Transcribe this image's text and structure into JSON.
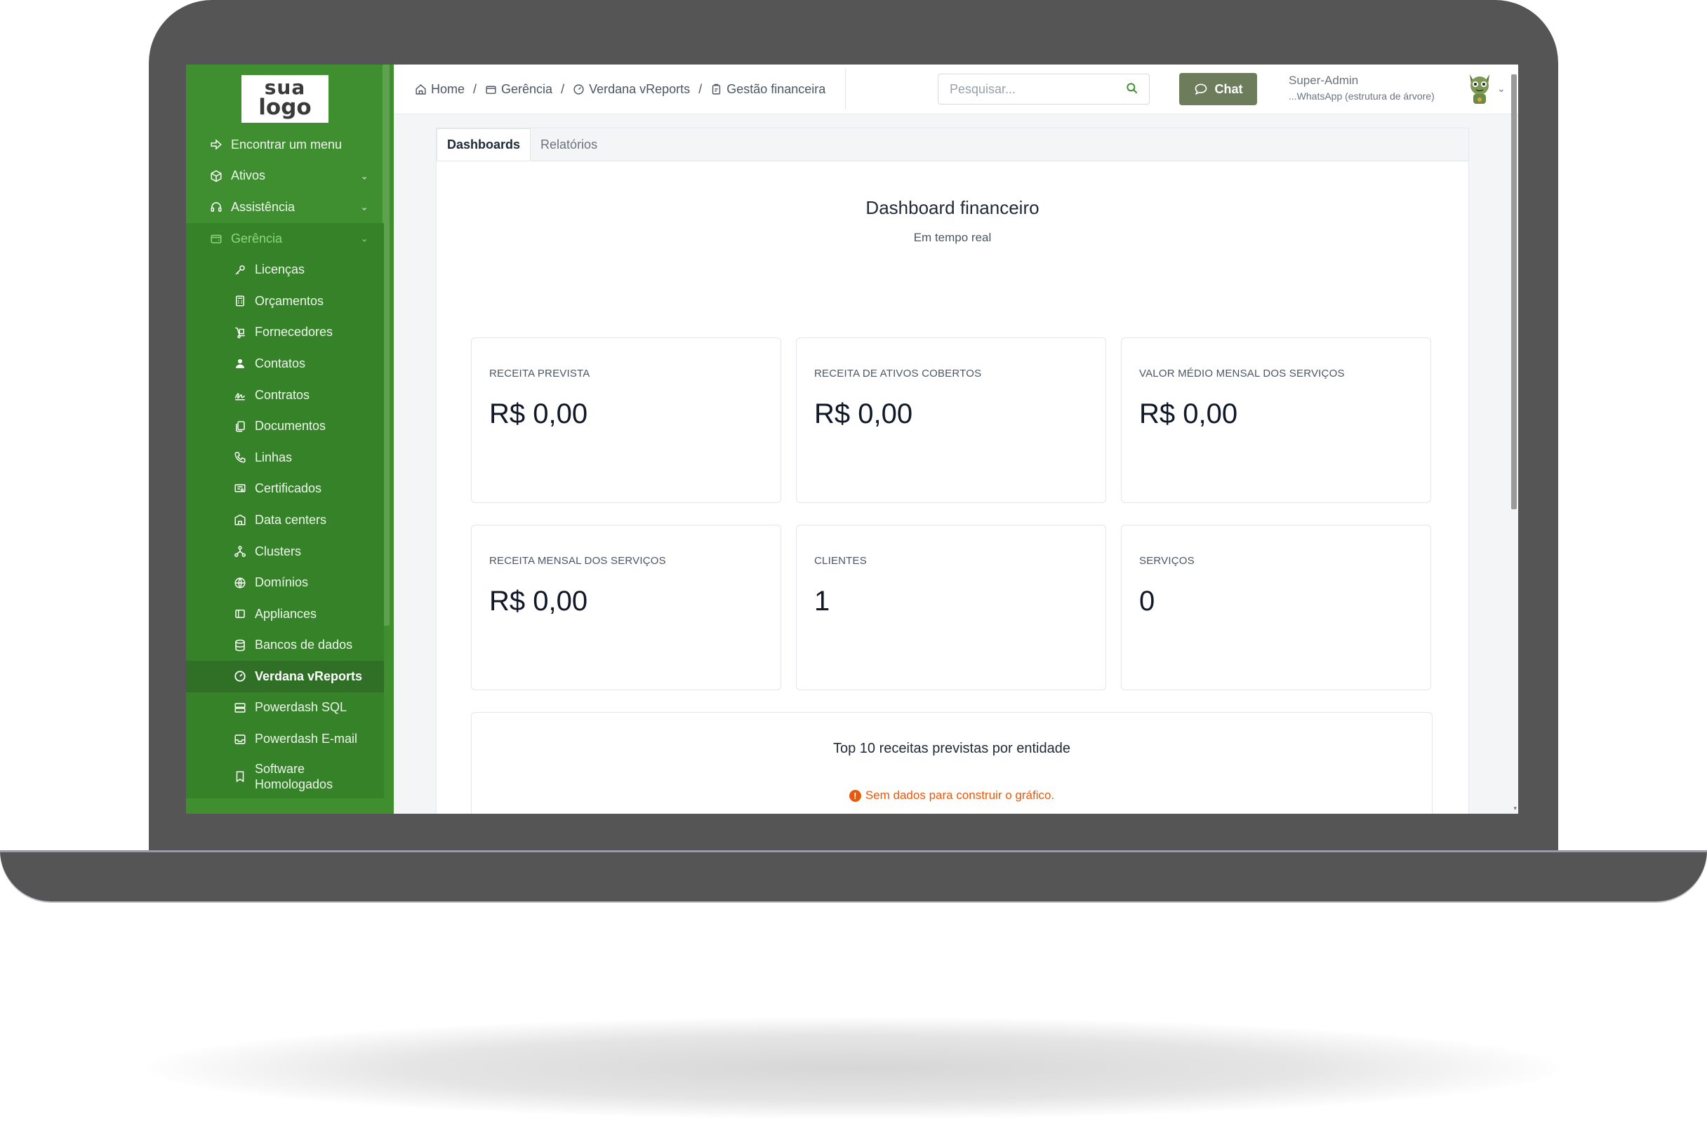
{
  "logo": {
    "line1": "sua",
    "line2": "logo"
  },
  "sidebar": {
    "items": [
      {
        "label": "Encontrar um menu",
        "icon": "arrow-right-icon"
      },
      {
        "label": "Ativos",
        "icon": "cube-icon"
      },
      {
        "label": "Assistência",
        "icon": "headset-icon"
      },
      {
        "label": "Gerência",
        "icon": "wallet-icon"
      }
    ],
    "subitems": [
      {
        "label": "Licenças",
        "icon": "key-icon"
      },
      {
        "label": "Orçamentos",
        "icon": "calculator-icon"
      },
      {
        "label": "Fornecedores",
        "icon": "dolly-icon"
      },
      {
        "label": "Contatos",
        "icon": "user-icon"
      },
      {
        "label": "Contratos",
        "icon": "signature-icon"
      },
      {
        "label": "Documentos",
        "icon": "files-icon"
      },
      {
        "label": "Linhas",
        "icon": "phone-icon"
      },
      {
        "label": "Certificados",
        "icon": "certificate-icon"
      },
      {
        "label": "Data centers",
        "icon": "building-icon"
      },
      {
        "label": "Clusters",
        "icon": "network-icon"
      },
      {
        "label": "Domínios",
        "icon": "globe-icon"
      },
      {
        "label": "Appliances",
        "icon": "device-icon"
      },
      {
        "label": "Bancos de dados",
        "icon": "database-icon"
      },
      {
        "label": "Verdana vReports",
        "icon": "gauge-icon"
      },
      {
        "label": "Powerdash SQL",
        "icon": "server-icon"
      },
      {
        "label": "Powerdash E-mail",
        "icon": "inbox-icon"
      },
      {
        "label": "Software Homologados",
        "icon": "bookmark-icon"
      }
    ]
  },
  "breadcrumb": {
    "home": "Home",
    "gerencia": "Gerência",
    "vreports": "Verdana vReports",
    "current": "Gestão financeira",
    "sep": "/"
  },
  "search": {
    "placeholder": "Pesquisar..."
  },
  "chat": {
    "label": "Chat"
  },
  "user": {
    "name": "Super-Admin",
    "entity": "...WhatsApp (estrutura de árvore)"
  },
  "tabs": [
    {
      "label": "Dashboards",
      "active": true
    },
    {
      "label": "Relatórios",
      "active": false
    }
  ],
  "dashboard": {
    "title": "Dashboard financeiro",
    "subtitle": "Em tempo real",
    "cards": [
      {
        "label": "RECEITA PREVISTA",
        "value": "R$ 0,00"
      },
      {
        "label": "RECEITA DE ATIVOS COBERTOS",
        "value": "R$ 0,00"
      },
      {
        "label": "VALOR MÉDIO MENSAL DOS SERVIÇOS",
        "value": "R$ 0,00"
      },
      {
        "label": "RECEITA MENSAL DOS SERVIÇOS",
        "value": "R$ 0,00"
      },
      {
        "label": "CLIENTES",
        "value": "1"
      },
      {
        "label": "SERVIÇOS",
        "value": "0"
      }
    ],
    "chart": {
      "title": "Top 10 receitas previstas por entidade",
      "warning": "Sem dados para construir o gráfico."
    }
  },
  "colors": {
    "sidebar": "#3f8f31",
    "accent": "#6d7c5b",
    "warning": "#ea580c"
  }
}
